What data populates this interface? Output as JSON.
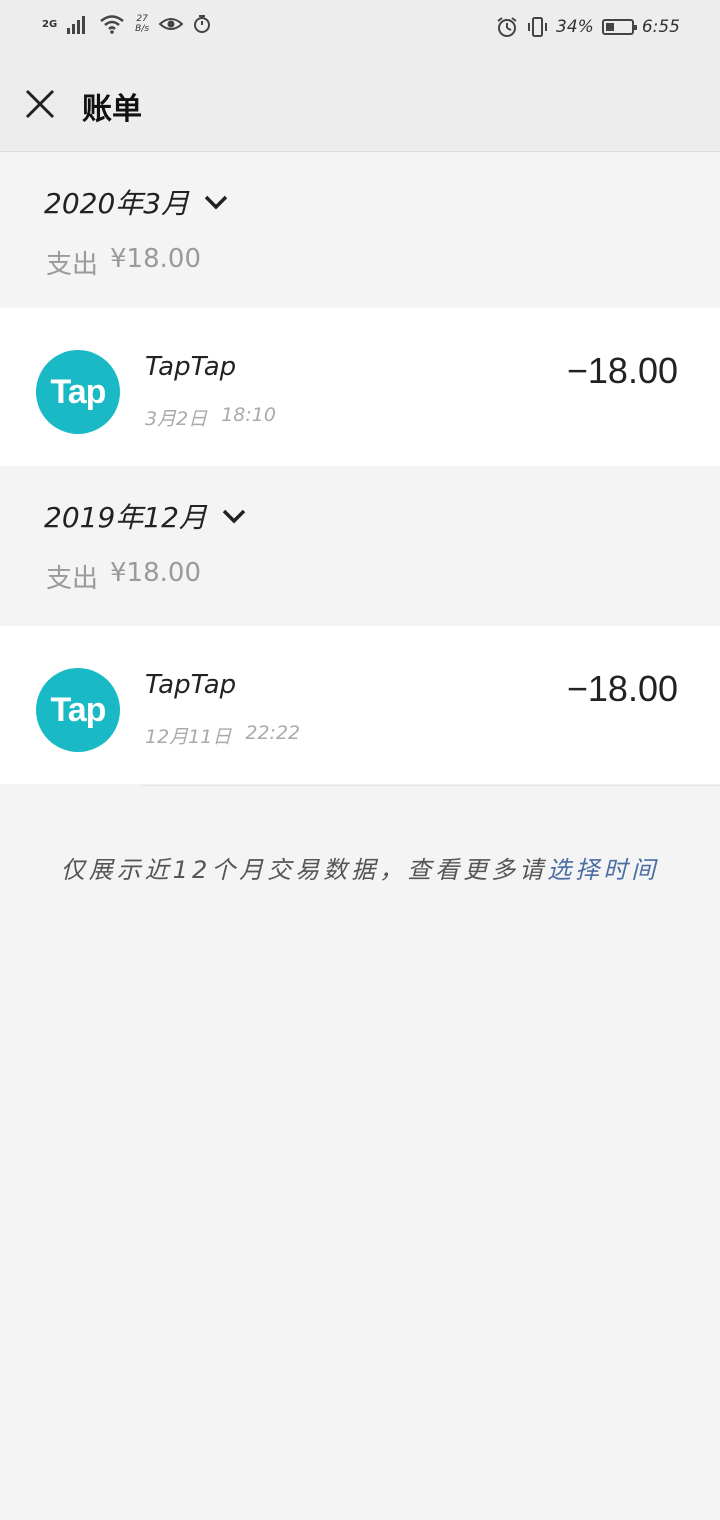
{
  "status_bar": {
    "network": "2G",
    "speed_value": "27",
    "speed_unit": "B/s",
    "battery_percent": "34%",
    "battery_level": 0.34,
    "time": "6:55"
  },
  "header": {
    "title": "账单"
  },
  "months": [
    {
      "label": "2020年3月",
      "expense_label": "支出",
      "expense_value": "¥18.00",
      "transaction": {
        "merchant": "TapTap",
        "date": "3月2日",
        "time": "18:10",
        "amount": "−18.00",
        "logo_text": "Tap"
      }
    },
    {
      "label": "2019年12月",
      "expense_label": "支出",
      "expense_value": "¥18.00",
      "transaction": {
        "merchant": "TapTap",
        "date": "12月11日",
        "time": "22:22",
        "amount": "−18.00",
        "logo_text": "Tap"
      }
    }
  ],
  "footer": {
    "note": "仅展示近12个月交易数据，查看更多请",
    "link": "选择时间"
  },
  "colors": {
    "logo_bg": "#19bac6",
    "link": "#4a6ea5"
  }
}
